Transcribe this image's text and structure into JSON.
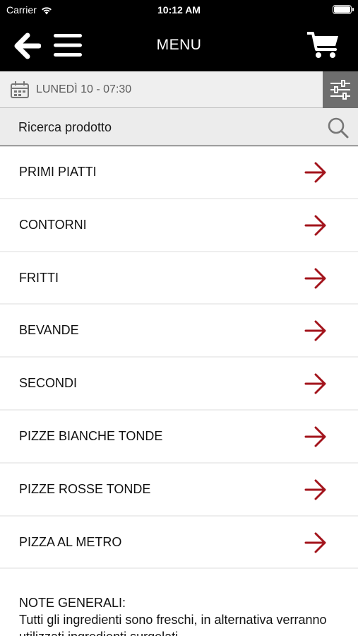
{
  "status_bar": {
    "carrier": "Carrier",
    "time": "10:12 AM"
  },
  "nav": {
    "title": "MENU"
  },
  "date_bar": {
    "date": "LUNEDÌ 10 - 07:30"
  },
  "search": {
    "placeholder": "Ricerca prodotto"
  },
  "categories": [
    {
      "label": "PRIMI PIATTI"
    },
    {
      "label": "CONTORNI"
    },
    {
      "label": "FRITTI"
    },
    {
      "label": "BEVANDE"
    },
    {
      "label": "SECONDI"
    },
    {
      "label": "PIZZE BIANCHE TONDE"
    },
    {
      "label": "PIZZE ROSSE TONDE"
    },
    {
      "label": "PIZZA AL METRO"
    }
  ],
  "notes": {
    "heading": "NOTE GENERALI:",
    "text": "Tutti gli ingredienti sono freschi, in alternativa verranno utilizzati ingredienti surgelati."
  },
  "colors": {
    "accent_arrow": "#a3141c",
    "nav_background": "#000000",
    "filter_button": "#6e6e6e"
  }
}
